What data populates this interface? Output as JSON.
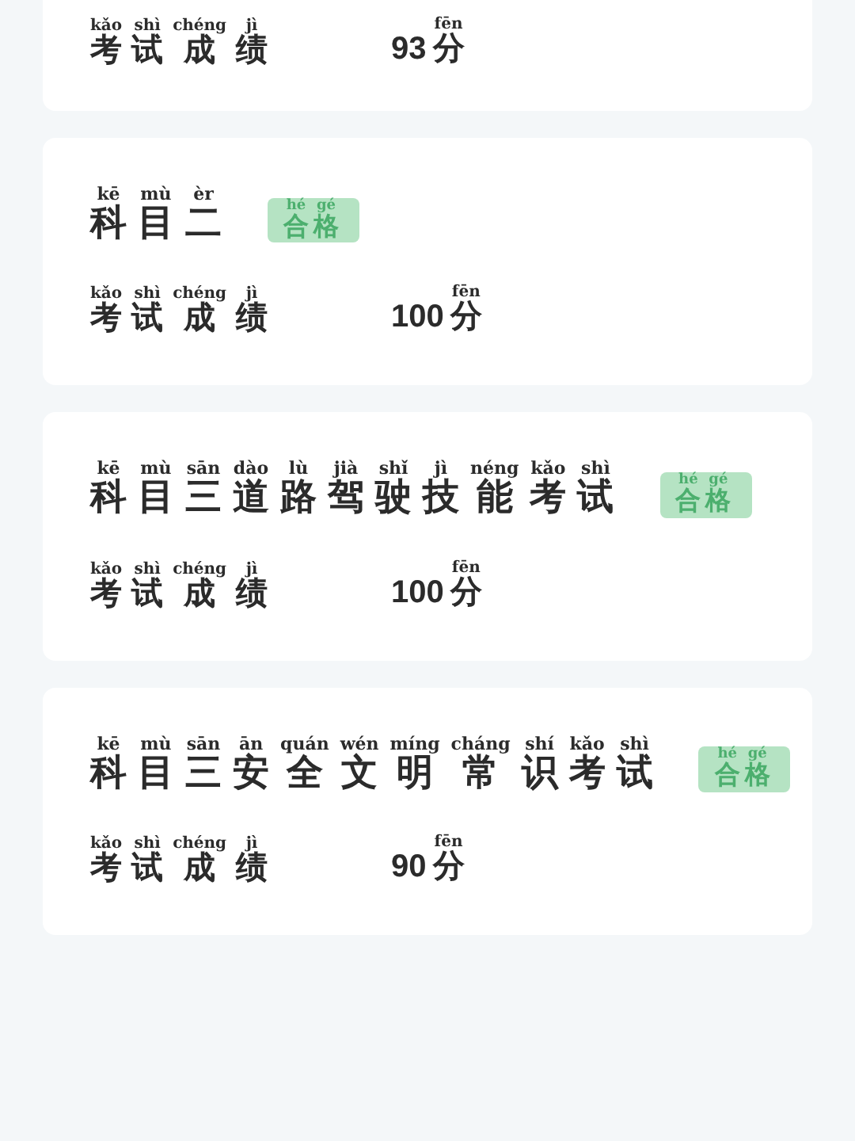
{
  "cards": [
    {
      "score_label": [
        {
          "hanzi": "考",
          "pinyin": "kǎo"
        },
        {
          "hanzi": "试",
          "pinyin": "shì"
        },
        {
          "hanzi": "成",
          "pinyin": "chéng"
        },
        {
          "hanzi": "绩",
          "pinyin": "jì"
        }
      ],
      "score": "93",
      "unit": {
        "hanzi": "分",
        "pinyin": "fēn"
      }
    },
    {
      "title": [
        {
          "hanzi": "科",
          "pinyin": "kē"
        },
        {
          "hanzi": "目",
          "pinyin": "mù"
        },
        {
          "hanzi": "二",
          "pinyin": "èr"
        }
      ],
      "badge": [
        {
          "hanzi": "合",
          "pinyin": "hé"
        },
        {
          "hanzi": "格",
          "pinyin": "gé"
        }
      ],
      "score_label": [
        {
          "hanzi": "考",
          "pinyin": "kǎo"
        },
        {
          "hanzi": "试",
          "pinyin": "shì"
        },
        {
          "hanzi": "成",
          "pinyin": "chéng"
        },
        {
          "hanzi": "绩",
          "pinyin": "jì"
        }
      ],
      "score": "100",
      "unit": {
        "hanzi": "分",
        "pinyin": "fēn"
      }
    },
    {
      "title": [
        {
          "hanzi": "科",
          "pinyin": "kē"
        },
        {
          "hanzi": "目",
          "pinyin": "mù"
        },
        {
          "hanzi": "三",
          "pinyin": "sān"
        },
        {
          "hanzi": "道",
          "pinyin": "dào"
        },
        {
          "hanzi": "路",
          "pinyin": "lù"
        },
        {
          "hanzi": "驾",
          "pinyin": "jià"
        },
        {
          "hanzi": "驶",
          "pinyin": "shǐ"
        },
        {
          "hanzi": "技",
          "pinyin": "jì"
        },
        {
          "hanzi": "能",
          "pinyin": "néng"
        },
        {
          "hanzi": "考",
          "pinyin": "kǎo"
        },
        {
          "hanzi": "试",
          "pinyin": "shì"
        }
      ],
      "badge": [
        {
          "hanzi": "合",
          "pinyin": "hé"
        },
        {
          "hanzi": "格",
          "pinyin": "gé"
        }
      ],
      "score_label": [
        {
          "hanzi": "考",
          "pinyin": "kǎo"
        },
        {
          "hanzi": "试",
          "pinyin": "shì"
        },
        {
          "hanzi": "成",
          "pinyin": "chéng"
        },
        {
          "hanzi": "绩",
          "pinyin": "jì"
        }
      ],
      "score": "100",
      "unit": {
        "hanzi": "分",
        "pinyin": "fēn"
      }
    },
    {
      "title": [
        {
          "hanzi": "科",
          "pinyin": "kē"
        },
        {
          "hanzi": "目",
          "pinyin": "mù"
        },
        {
          "hanzi": "三",
          "pinyin": "sān"
        },
        {
          "hanzi": "安",
          "pinyin": "ān"
        },
        {
          "hanzi": "全",
          "pinyin": "quán"
        },
        {
          "hanzi": "文",
          "pinyin": "wén"
        },
        {
          "hanzi": "明",
          "pinyin": "míng"
        },
        {
          "hanzi": "常",
          "pinyin": "cháng"
        },
        {
          "hanzi": "识",
          "pinyin": "shí"
        },
        {
          "hanzi": "考",
          "pinyin": "kǎo"
        },
        {
          "hanzi": "试",
          "pinyin": "shì"
        }
      ],
      "badge": [
        {
          "hanzi": "合",
          "pinyin": "hé"
        },
        {
          "hanzi": "格",
          "pinyin": "gé"
        }
      ],
      "score_label": [
        {
          "hanzi": "考",
          "pinyin": "kǎo"
        },
        {
          "hanzi": "试",
          "pinyin": "shì"
        },
        {
          "hanzi": "成",
          "pinyin": "chéng"
        },
        {
          "hanzi": "绩",
          "pinyin": "jì"
        }
      ],
      "score": "90",
      "unit": {
        "hanzi": "分",
        "pinyin": "fēn"
      }
    }
  ]
}
